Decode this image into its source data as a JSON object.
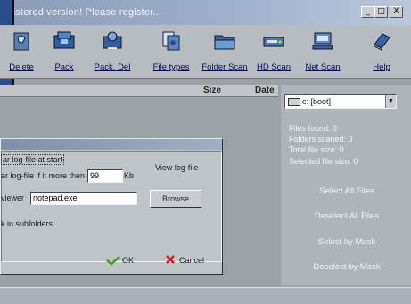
{
  "window": {
    "title": "egistered version! Please register...",
    "controls": [
      "_",
      "□",
      "X"
    ]
  },
  "toolbar": {
    "buttons": [
      {
        "label": "Delete",
        "icon": "recycle-bin-icon"
      },
      {
        "label": "Pack",
        "icon": "pack-icon"
      },
      {
        "label": "Pack, Del",
        "icon": "pack-delete-icon"
      },
      {
        "label": "File types",
        "icon": "file-types-icon"
      },
      {
        "label": "Folder Scan",
        "icon": "folder-scan-icon"
      },
      {
        "label": "HD Scan",
        "icon": "hd-scan-icon"
      },
      {
        "label": "Net Scan",
        "icon": "net-scan-icon"
      },
      {
        "label": "Help",
        "icon": "help-book-icon"
      }
    ]
  },
  "list": {
    "columns": [
      "Size",
      "Date"
    ]
  },
  "drive_select": {
    "value": "c: [boot]"
  },
  "stats": {
    "files_found": "Files found: 0",
    "folders_scanned": "Folders scaned: 0",
    "total_size": "Total file size: 0",
    "selected_size": "Selected file size: 0"
  },
  "actions": {
    "select_all": "Select All Files",
    "deselect_all": "Deselect All Files",
    "select_mask": "Select by Mask",
    "deselect_mask": "Deselect by Mask"
  },
  "dialog": {
    "clear_at_start": "ar log-file at start",
    "clear_if_more": "ar log-file if it more then",
    "size_value": "99",
    "size_unit": "Kb",
    "view_log": "View log-file",
    "viewer_label": "viewer",
    "viewer_value": "notepad.exe",
    "browse": "Browse",
    "subfolders": "k in subfolders",
    "ok": "OK",
    "cancel": "Cancel"
  },
  "colors": {
    "title_gradient_start": "#8a9ab8",
    "toolbar_label": "#0b0b55",
    "ok_icon": "#4a9a2a",
    "cancel_icon": "#d02020"
  }
}
